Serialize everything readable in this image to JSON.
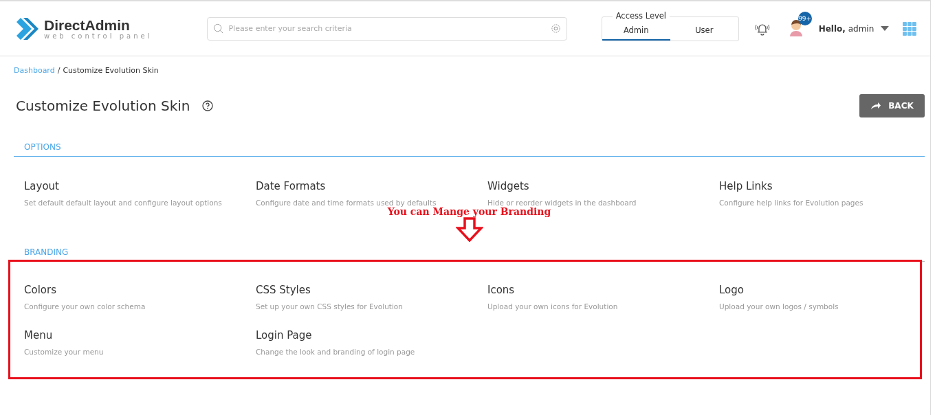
{
  "header": {
    "logo": {
      "name": "DirectAdmin",
      "tagline": "web control panel"
    },
    "search": {
      "placeholder": "Please enter your search criteria"
    },
    "access_level": {
      "title": "Access Level",
      "tabs": [
        {
          "label": "Admin",
          "selected": true
        },
        {
          "label": "User",
          "selected": false
        }
      ]
    },
    "notifications_badge": "99+",
    "greeting": {
      "hello": "Hello,",
      "user": "admin"
    }
  },
  "breadcrumb": {
    "link": "Dashboard",
    "separator": "/",
    "current": "Customize Evolution Skin"
  },
  "page_title": "Customize Evolution Skin",
  "back_button": "BACK",
  "sections": [
    {
      "heading": "OPTIONS",
      "highlighted": false,
      "items": [
        {
          "title": "Layout",
          "description": "Set default default layout and configure layout options"
        },
        {
          "title": "Date Formats",
          "description": "Configure date and time formats used by defaults"
        },
        {
          "title": "Widgets",
          "description": "Hide or reorder widgets in the dashboard"
        },
        {
          "title": "Help Links",
          "description": "Configure help links for Evolution pages"
        }
      ]
    },
    {
      "heading": "BRANDING",
      "highlighted": true,
      "items": [
        {
          "title": "Colors",
          "description": "Configure your own color schema"
        },
        {
          "title": "CSS Styles",
          "description": "Set up your own CSS styles for Evolution"
        },
        {
          "title": "Icons",
          "description": "Upload your own icons for Evolution"
        },
        {
          "title": "Logo",
          "description": "Upload your own logos / symbols"
        },
        {
          "title": "Menu",
          "description": "Customize your menu"
        },
        {
          "title": "Login Page",
          "description": "Change the look and branding of login page"
        }
      ]
    }
  ],
  "annotation": "You can Mange your Branding"
}
